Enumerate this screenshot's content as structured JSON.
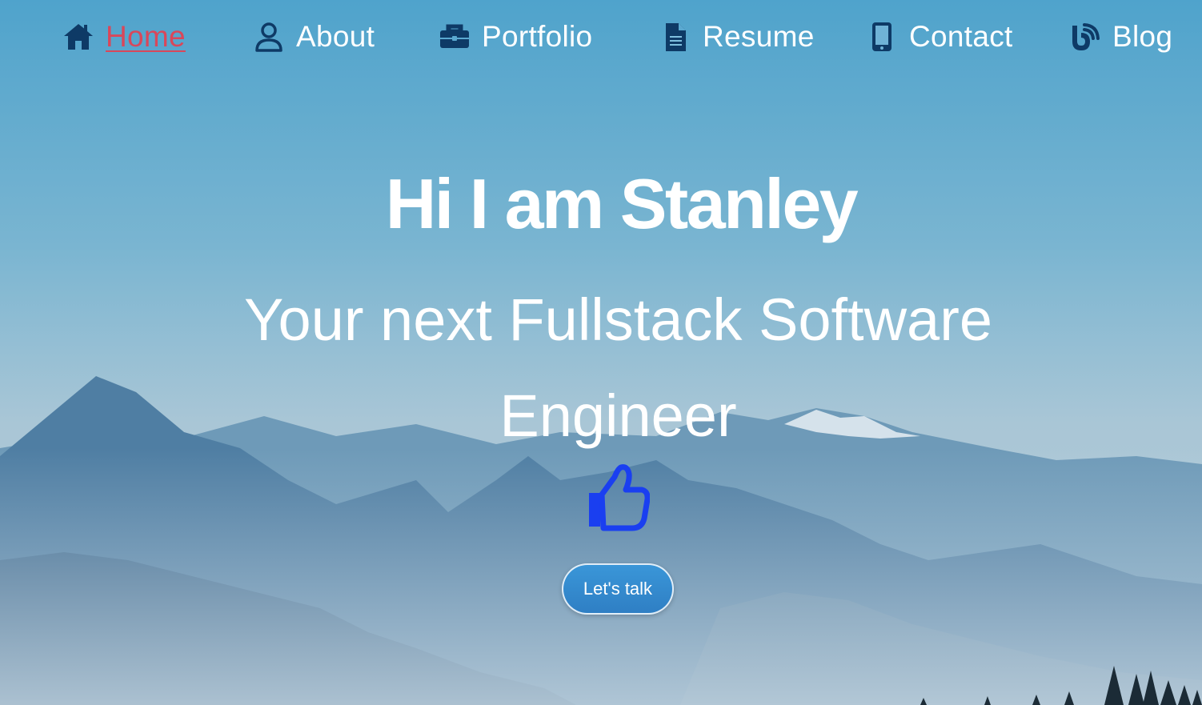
{
  "nav": {
    "items": [
      {
        "label": "Home",
        "icon": "home-icon",
        "active": true
      },
      {
        "label": "About",
        "icon": "user-icon",
        "active": false
      },
      {
        "label": "Portfolio",
        "icon": "briefcase-icon",
        "active": false
      },
      {
        "label": "Resume",
        "icon": "document-icon",
        "active": false
      },
      {
        "label": "Contact",
        "icon": "mobile-phone-icon",
        "active": false
      },
      {
        "label": "Blog",
        "icon": "rss-blog-icon",
        "active": false
      }
    ],
    "active_color": "#d9475a",
    "icon_color": "#0e3a66"
  },
  "hero": {
    "title": "Hi I am Stanley",
    "subtitle_line1": "Your next Fullstack Software",
    "subtitle_line2": "Engineer",
    "thumb_icon": "thumbs-up-icon",
    "thumb_color": "#1a3ff0",
    "cta_label": "Let's talk"
  },
  "background": {
    "scene": "mountain-landscape",
    "sky_color": "#4fa3cc"
  }
}
